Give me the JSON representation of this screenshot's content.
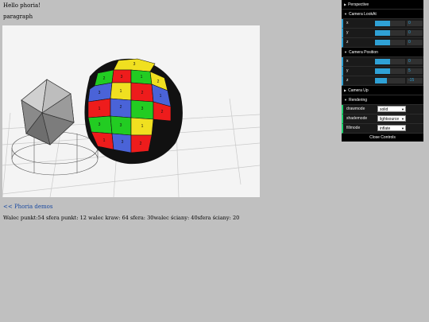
{
  "heading": "Hello phoria!",
  "paragraph": "paragraph",
  "back_link": "<< Phoria demos",
  "stats": "Walec punkt:54 sfera punkt: 12 walec kraw: 64 sfera: 30walec ściany: 40sfera ściany: 20",
  "gui": {
    "folders": [
      {
        "title": "Perspective"
      },
      {
        "title": "Camera LookAt"
      },
      {
        "title": "Camera Position"
      },
      {
        "title": "Camera Up"
      },
      {
        "title": "Rendering"
      }
    ],
    "lookat": [
      {
        "label": "x",
        "value": "0",
        "fill": 0.5
      },
      {
        "label": "y",
        "value": "0",
        "fill": 0.5
      },
      {
        "label": "z",
        "value": "0",
        "fill": 0.5
      }
    ],
    "position": [
      {
        "label": "x",
        "value": "0",
        "fill": 0.5
      },
      {
        "label": "y",
        "value": "5",
        "fill": 0.5
      },
      {
        "label": "z",
        "value": "-15",
        "fill": 0.4
      }
    ],
    "rendering": [
      {
        "label": "drawmode",
        "value": "solid"
      },
      {
        "label": "shademode",
        "value": "lightsource"
      },
      {
        "label": "fillmode",
        "value": "inflate"
      }
    ],
    "close": "Close Controls"
  },
  "colors": {
    "accent": "#2fa1d6",
    "select_accent": "#1ed36f",
    "cube_red": "#ee1c1c",
    "cube_green": "#22cc22",
    "cube_yellow": "#f0e020",
    "cube_blue": "#4a63d8"
  }
}
